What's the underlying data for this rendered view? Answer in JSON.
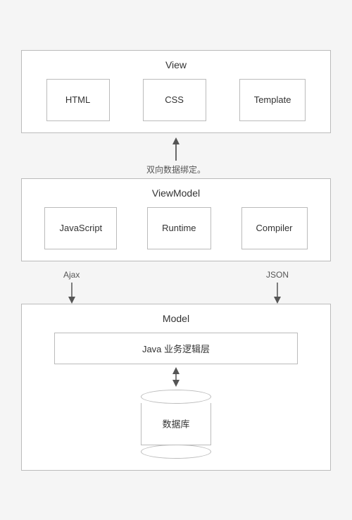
{
  "view": {
    "title": "View",
    "items": [
      "HTML",
      "CSS",
      "Template"
    ]
  },
  "arrow_middle": {
    "label": "双向数据绑定。"
  },
  "viewmodel": {
    "title": "ViewModel",
    "items": [
      "JavaScript",
      "Runtime",
      "Compiler"
    ]
  },
  "arrow_bottom": {
    "left_label": "Ajax",
    "right_label": "JSON"
  },
  "model": {
    "title": "Model",
    "java_label": "Java 业务逻辑层",
    "db_label": "数据库"
  }
}
